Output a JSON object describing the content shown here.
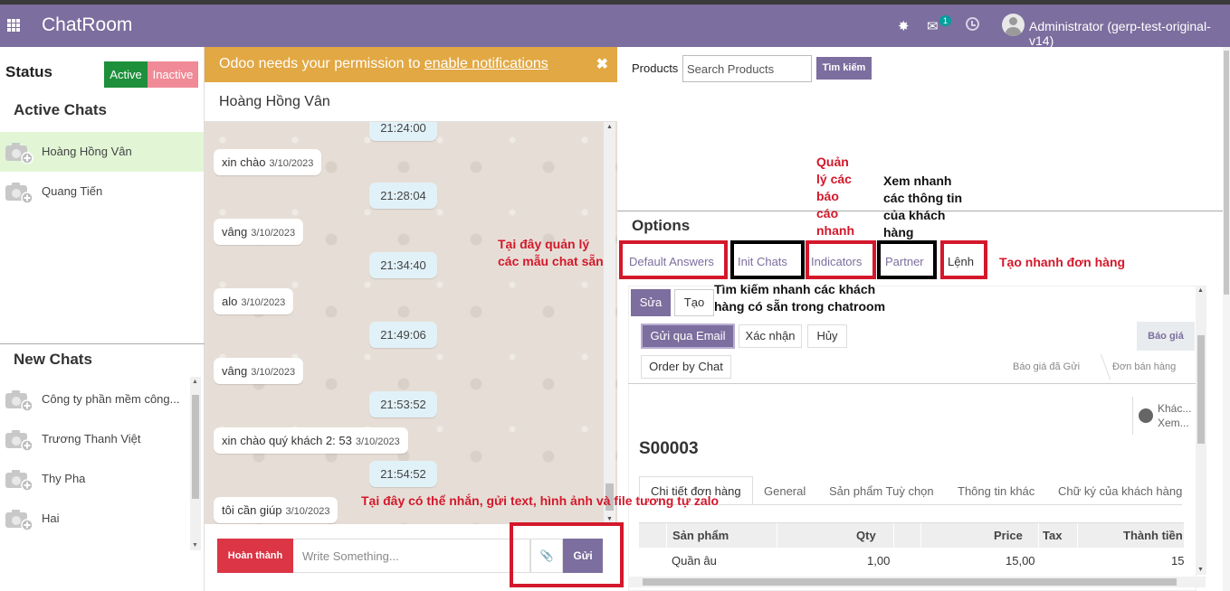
{
  "app": {
    "title": "ChatRoom",
    "notification_count": "1",
    "user": "Administrator (gerp-test-original-v14)"
  },
  "sidebar": {
    "status_label": "Status",
    "active_button": "Active",
    "inactive_button": "Inactive",
    "active_chats_title": "Active Chats",
    "active_chats": [
      "Hoàng Hồng Vân",
      "Quang Tiến"
    ],
    "new_chats_title": "New Chats",
    "new_chats": [
      "Công ty phần mềm công...",
      "Trương Thanh Việt",
      "Thy Pha",
      "Hai"
    ]
  },
  "chat": {
    "notification_text": "Odoo needs your permission to ",
    "notification_link": "enable notifications",
    "notification_close": "✖",
    "partner_name": "Hoàng Hồng Vân",
    "messages": [
      {
        "dir": "out",
        "text": "21:24:00"
      },
      {
        "dir": "in",
        "text": "xin chào",
        "date": "3/10/2023"
      },
      {
        "dir": "out",
        "text": "21:28:04"
      },
      {
        "dir": "in",
        "text": "vâng",
        "date": "3/10/2023"
      },
      {
        "dir": "out",
        "text": "21:34:40"
      },
      {
        "dir": "in",
        "text": "alo",
        "date": "3/10/2023"
      },
      {
        "dir": "out",
        "text": "21:49:06"
      },
      {
        "dir": "in",
        "text": "vâng",
        "date": "3/10/2023"
      },
      {
        "dir": "out",
        "text": "21:53:52"
      },
      {
        "dir": "in",
        "text": "xin chào quý khách 2: 53",
        "date": "3/10/2023"
      },
      {
        "dir": "out",
        "text": "21:54:52"
      },
      {
        "dir": "in",
        "text": "tôi cần giúp",
        "date": "3/10/2023"
      }
    ],
    "done_button": "Hoàn thành",
    "input_placeholder": "Write Something...",
    "send_button": "Gửi"
  },
  "products": {
    "label": "Products",
    "search_placeholder": "Search Products",
    "search_button": "Tìm kiếm"
  },
  "options": {
    "title": "Options",
    "tabs": [
      "Default Answers",
      "Init Chats",
      "Indicators",
      "Partner",
      "Lệnh"
    ]
  },
  "order_form": {
    "edit_button": "Sửa",
    "create_button": "Tạo",
    "send_email_button": "Gửi qua Email",
    "confirm_button": "Xác nhận",
    "cancel_button": "Hủy",
    "order_by_chat_button": "Order by Chat",
    "quote_button": "Báo giá",
    "stages": [
      "Báo giá đã Gửi",
      "Đơn bán hàng"
    ],
    "smart_button_line1": "Khác...",
    "smart_button_line2": "Xem...",
    "order_number": "S00003",
    "notebook_tabs": [
      "Chi tiết đơn hàng",
      "General",
      "Sản phẩm Tuỳ chọn",
      "Thông tin khác",
      "Chữ ký của khách hàng"
    ],
    "table": {
      "headers": [
        "Sản phẩm",
        "Qty",
        "Price",
        "Tax",
        "Thành tiền"
      ],
      "rows": [
        [
          "Quần âu",
          "1,00",
          "15,00",
          "",
          "15"
        ]
      ]
    }
  },
  "annotations": {
    "templates_note": "Tại đây quản lý các mẫu chat sẵn",
    "indicators_note": "Quản lý các báo cáo nhanh",
    "partner_note": "Xem nhanh các thông tin của khách hàng",
    "order_note": "Tạo nhanh đơn hàng",
    "init_chats_note": "Tìm kiếm nhanh các khách hàng có sẵn trong chatroom",
    "composer_note": "Tại đây có thể nhắn, gửi text, hình ảnh và file tương tự zalo"
  },
  "colors": {
    "brand": "#7c6e9e",
    "active_green": "#1e8f3a",
    "inactive_pink": "#f08a96",
    "notice_orange": "#e2a843",
    "danger_red": "#dc3545",
    "annotation_red": "#d3182b"
  }
}
